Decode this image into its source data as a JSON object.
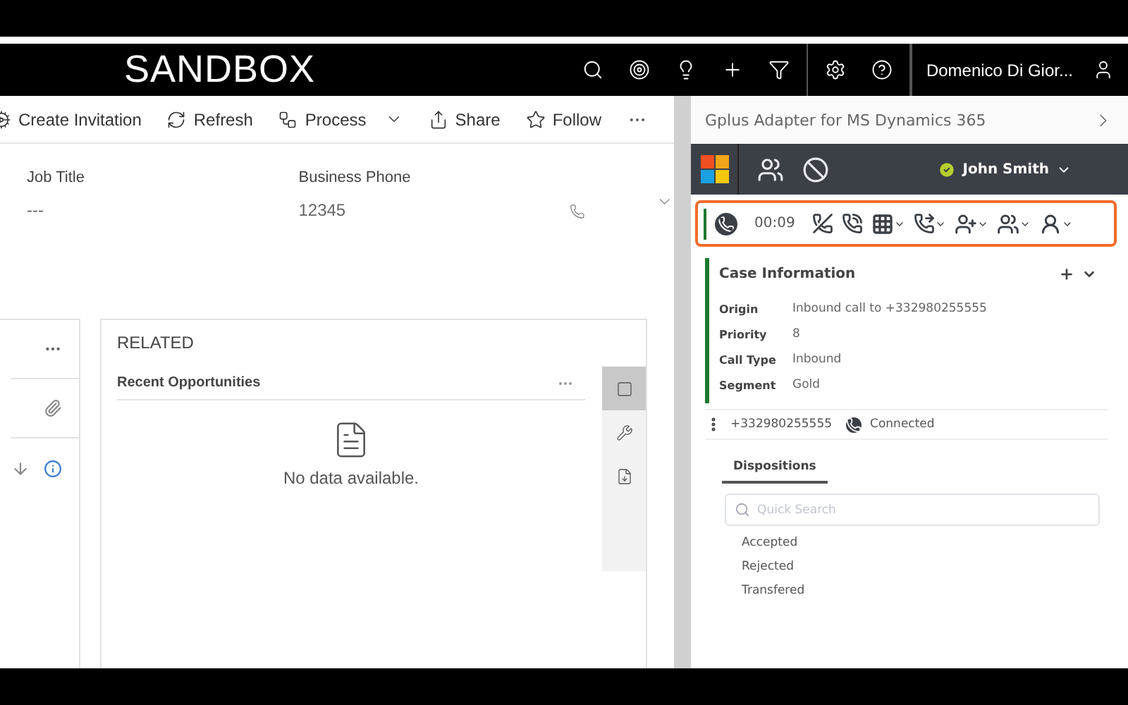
{
  "app_title": "SANDBOX",
  "nav_user": "Domenico Di Gior...",
  "command_bar": [
    {
      "label": "Create Invitation",
      "dropdown": false
    },
    {
      "label": "Refresh",
      "dropdown": false
    },
    {
      "label": "Process",
      "dropdown": true
    },
    {
      "label": "Share",
      "dropdown": false
    },
    {
      "label": "Follow",
      "dropdown": false
    }
  ],
  "fields": [
    {
      "label": "Job Title",
      "value": "---"
    },
    {
      "label": "Business Phone",
      "value": "12345"
    }
  ],
  "related": {
    "title": "RELATED",
    "section": "Recent Opportunities",
    "empty": "No data available.",
    "side_tabs": [
      {
        "selected": true
      },
      {
        "selected": false
      },
      {
        "selected": false
      }
    ]
  },
  "adapter": {
    "title": "Gplus Adapter for MS Dynamics 365",
    "agent": "John Smith",
    "agent_ready": true,
    "call_timer": "00:09",
    "case": {
      "title": "Case Information",
      "fields": [
        {
          "label": "Origin",
          "value": "Inbound call to +332980255555"
        },
        {
          "label": "Priority",
          "value": "8"
        },
        {
          "label": "Call Type",
          "value": "Inbound"
        },
        {
          "label": "Segment",
          "value": "Gold"
        }
      ]
    },
    "call": {
      "number": "+332980255555",
      "status": "Connected"
    },
    "tabs": [
      {
        "label": "Dispositions",
        "selected": true
      }
    ],
    "search": {
      "placeholder": "Quick Search"
    },
    "dispositions": [
      "Accepted",
      "Rejected",
      "Transfered"
    ]
  }
}
